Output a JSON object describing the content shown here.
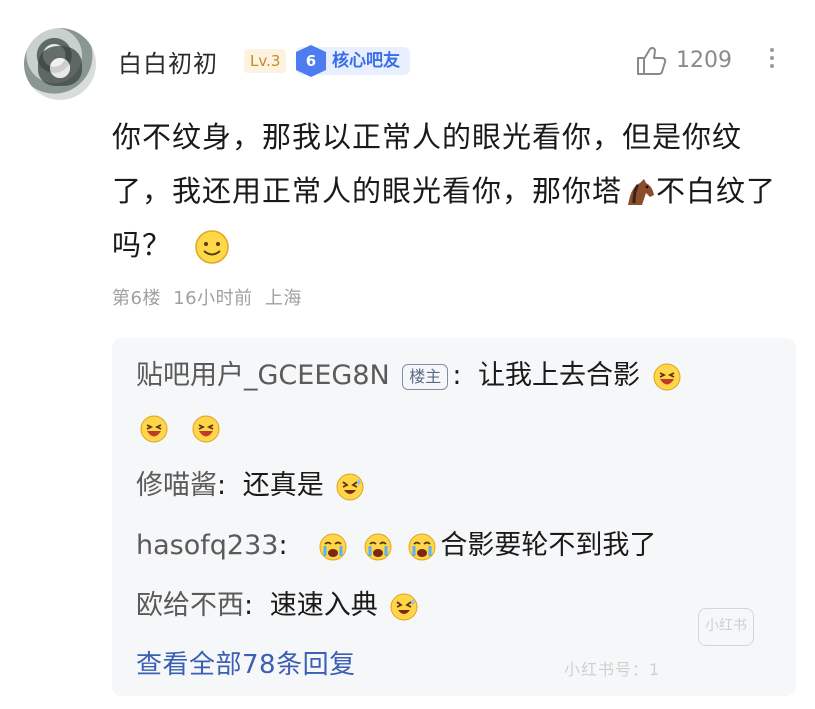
{
  "comment": {
    "username": "白白初初",
    "level": "Lv.3",
    "fan_level": "6",
    "fan_title": "核心吧友",
    "like_count": "1209",
    "body_text": "你不纹身，那我以正常人的眼光看你，但是你纹了，我还用正常人的眼光看你，那你塔",
    "body_text_2": "不白纹了吗？",
    "floor": "第6楼",
    "time": "16小时前",
    "location": "上海"
  },
  "replies": [
    {
      "name": "贴吧用户_GCEEG8N",
      "tag": "楼主",
      "text": "让我上去合影"
    },
    {
      "name": "修喵酱",
      "text": "还真是"
    },
    {
      "name": "hasofq233",
      "text": "合影要轮不到我了"
    },
    {
      "name": "欧给不西",
      "text": "速速入典"
    }
  ],
  "reply_separator": ":",
  "view_all": "查看全部78条回复",
  "watermark": {
    "logo": "小红书",
    "id_text": "小红书号：1"
  },
  "colors": {
    "link": "#3a5fb5",
    "fan_badge": "#4d7cf0",
    "level_badge": "#c48a2c",
    "reply_bg": "#f6f7f8"
  },
  "icons": [
    "thumbs-up-icon",
    "more-vertical-icon",
    "smile-emoji",
    "horse-emoji",
    "laughing-emoji",
    "crying-emoji",
    "grinning-sweat-emoji"
  ]
}
